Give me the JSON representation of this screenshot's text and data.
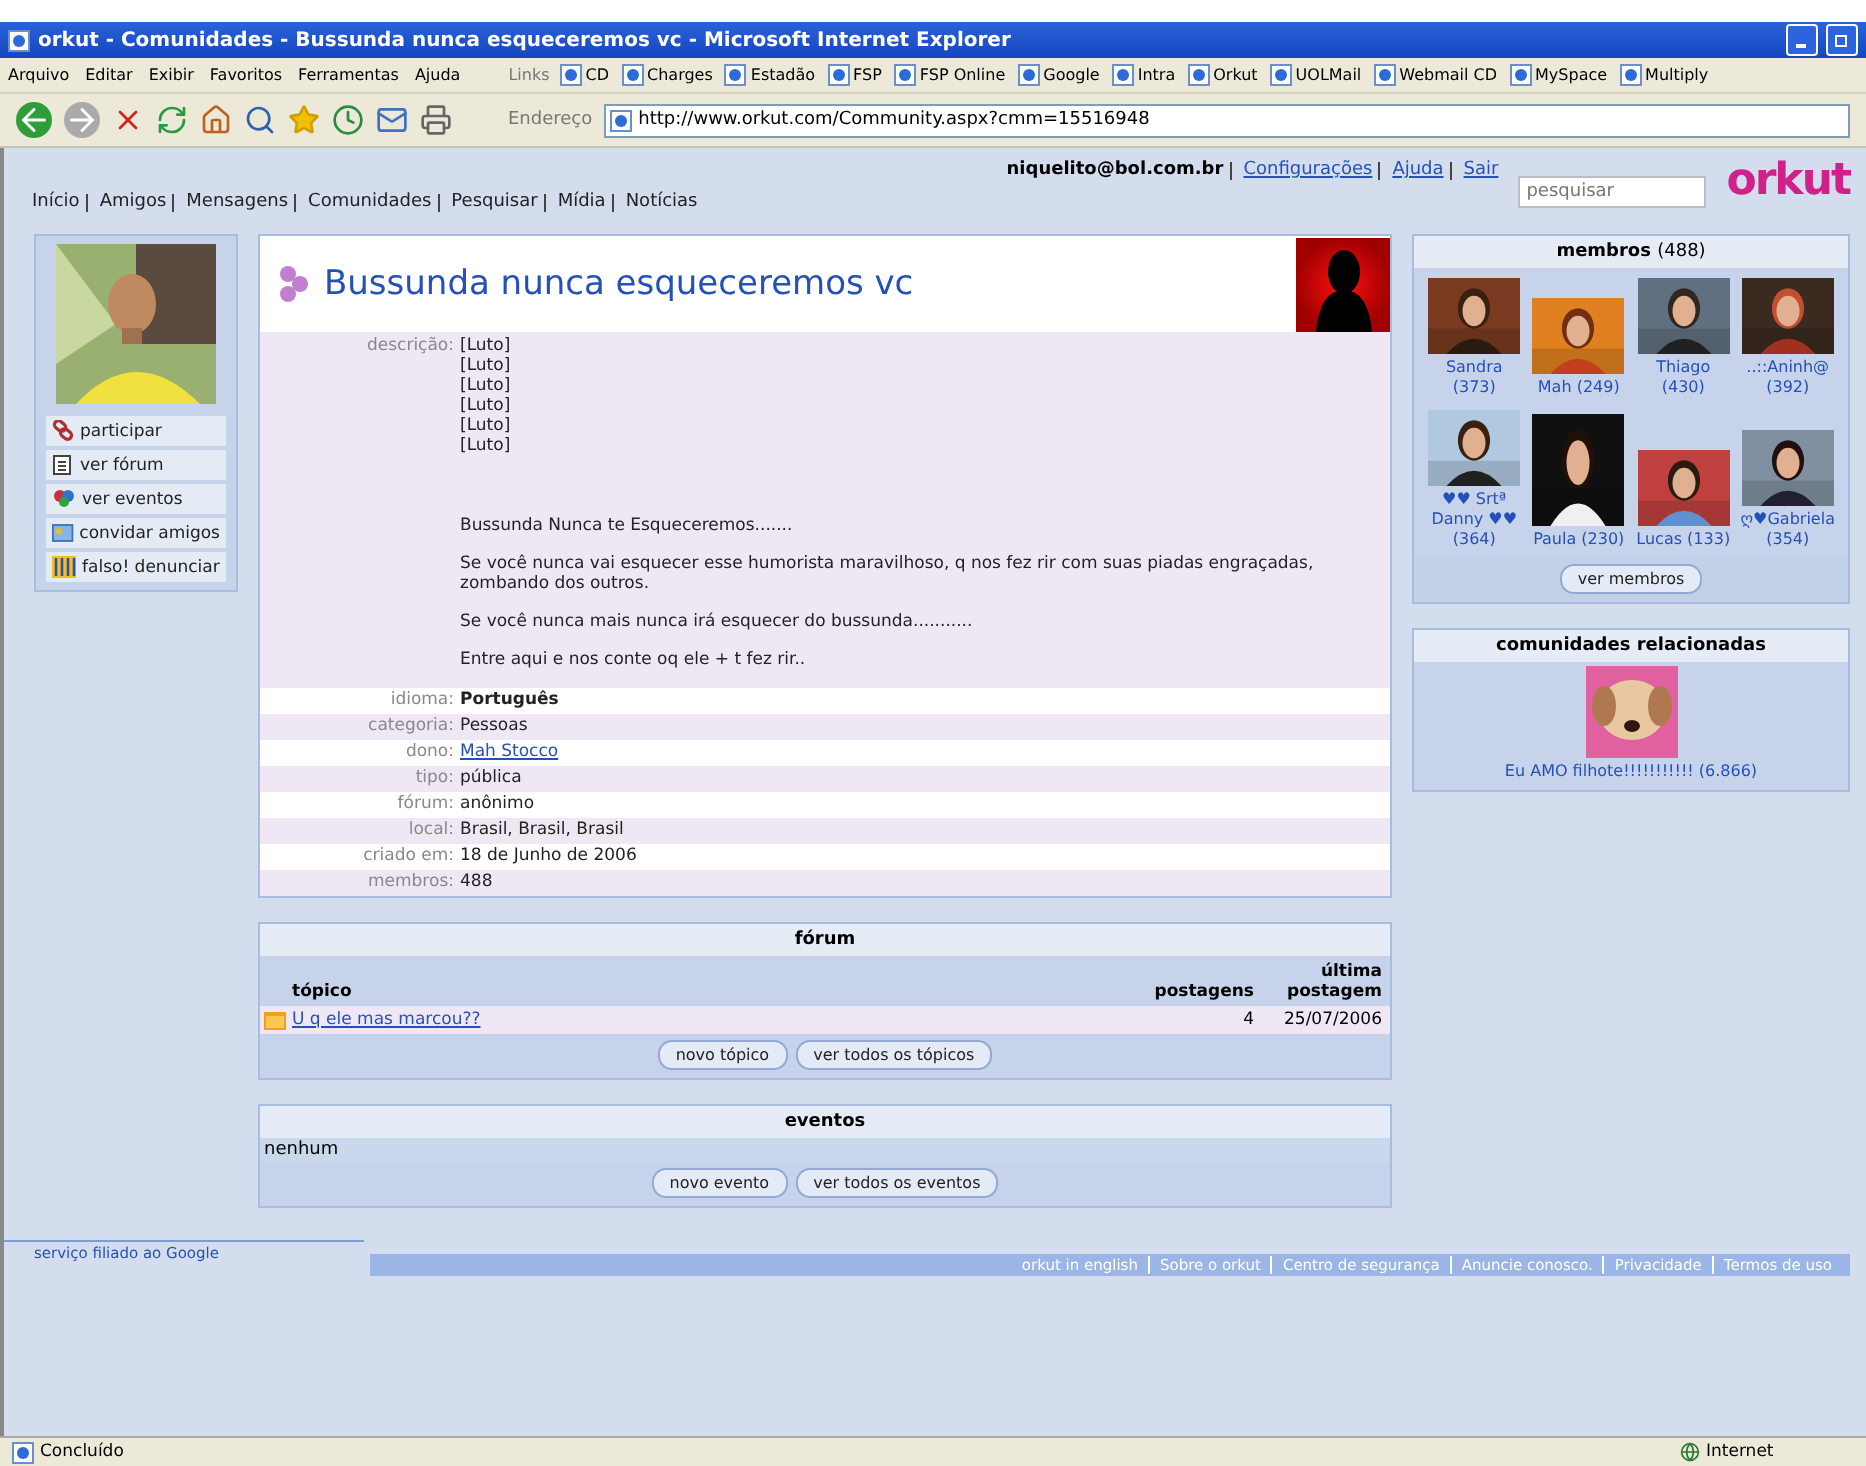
{
  "window": {
    "title": "orkut - Comunidades - Bussunda nunca esqueceremos vc - Microsoft Internet Explorer"
  },
  "menu": [
    "Arquivo",
    "Editar",
    "Exibir",
    "Favoritos",
    "Ferramentas",
    "Ajuda"
  ],
  "links_bar": {
    "label": "Links",
    "items": [
      "CD",
      "Charges",
      "Estadão",
      "FSP",
      "FSP Online",
      "Google",
      "Intra",
      "Orkut",
      "UOLMail",
      "Webmail CD",
      "MySpace",
      "Multiply"
    ]
  },
  "address": {
    "label": "Endereço",
    "url": "http://www.orkut.com/Community.aspx?cmm=15516948"
  },
  "header": {
    "user": "niquelito@bol.com.br",
    "user_links": [
      "Configurações",
      "Ajuda",
      "Sair"
    ],
    "nav": [
      "Início",
      "Amigos",
      "Mensagens",
      "Comunidades",
      "Pesquisar",
      "Mídia",
      "Notícias"
    ],
    "search": {
      "placeholder": "pesquisar"
    },
    "logo": "orkut"
  },
  "actions": [
    {
      "kind": "join",
      "label": "participar"
    },
    {
      "kind": "forum",
      "label": "ver fórum"
    },
    {
      "kind": "events",
      "label": "ver eventos"
    },
    {
      "kind": "invite",
      "label": "convidar amigos"
    },
    {
      "kind": "report",
      "label": "falso! denunciar"
    }
  ],
  "community": {
    "title": "Bussunda nunca esqueceremos vc",
    "description": {
      "label": "descrição:",
      "lines": [
        "[Luto]",
        "[Luto]",
        "[Luto]",
        "[Luto]",
        "[Luto]",
        "[Luto]"
      ],
      "paragraphs": [
        "Bussunda Nunca te Esqueceremos.......",
        "Se você nunca vai esquecer esse humorista maravilhoso, q nos fez rir com suas piadas engraçadas, zombando dos outros.",
        "Se você nunca mais nunca irá esquecer do bussunda...........",
        "Entre aqui e nos conte oq ele + t fez rir.."
      ]
    },
    "fields": [
      {
        "label": "idioma:",
        "value": "Português",
        "kind": "bold"
      },
      {
        "label": "categoria:",
        "value": "Pessoas",
        "kind": "text"
      },
      {
        "label": "dono:",
        "value": "Mah Stocco",
        "kind": "link"
      },
      {
        "label": "tipo:",
        "value": "pública",
        "kind": "text"
      },
      {
        "label": "fórum:",
        "value": "anônimo",
        "kind": "text"
      },
      {
        "label": "local:",
        "value": "Brasil, Brasil, Brasil",
        "kind": "text"
      },
      {
        "label": "criado em:",
        "value": "18 de Junho de 2006",
        "kind": "text"
      },
      {
        "label": "membros:",
        "value": "488",
        "kind": "text"
      }
    ]
  },
  "forum": {
    "title": "fórum",
    "columns": [
      "tópico",
      "postagens",
      "última postagem"
    ],
    "topics": [
      {
        "title": "U q ele mas marcou??",
        "posts": "4",
        "last": "25/07/2006"
      }
    ],
    "buttons": [
      "novo tópico",
      "ver todos os tópicos"
    ]
  },
  "events": {
    "title": "eventos",
    "empty": "nenhum",
    "buttons": [
      "novo evento",
      "ver todos os eventos"
    ]
  },
  "members": {
    "title": "membros",
    "count": "(488)",
    "items": [
      {
        "name": "Sandra (373)"
      },
      {
        "name": "Mah (249)"
      },
      {
        "name": "Thiago (430)"
      },
      {
        "name": "..::Aninh@ (392)"
      },
      {
        "name": "♥♥ Srtª Danny ♥♥ (364)"
      },
      {
        "name": "Paula (230)"
      },
      {
        "name": "Lucas (133)"
      },
      {
        "name": "ღ♥Gabriela (354)"
      }
    ],
    "button": "ver membros"
  },
  "related": {
    "title": "comunidades relacionadas",
    "items": [
      {
        "name": "Eu AMO filhote!!!!!!!!!!! (6.866)"
      }
    ]
  },
  "footer": {
    "tagline": "serviço filiado ao Google",
    "links": [
      "orkut in english",
      "Sobre o orkut",
      "Centro de segurança",
      "Anuncie conosco.",
      "Privacidade",
      "Termos de uso"
    ]
  },
  "status": {
    "text": "Concluído",
    "zone": "Internet"
  }
}
